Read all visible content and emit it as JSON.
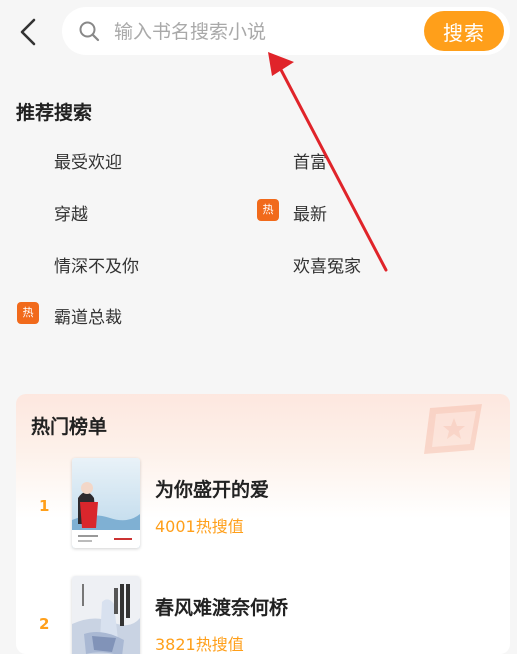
{
  "search": {
    "placeholder": "输入书名搜索小说",
    "button_label": "搜索"
  },
  "recommend": {
    "title": "推荐搜索",
    "hot_tag_label": "热",
    "items": [
      {
        "label": "最受欢迎",
        "hot": false
      },
      {
        "label": "首富",
        "hot": false
      },
      {
        "label": "穿越",
        "hot": false
      },
      {
        "label": "最新",
        "hot": true
      },
      {
        "label": "情深不及你",
        "hot": false
      },
      {
        "label": "欢喜冤家",
        "hot": false
      },
      {
        "label": "霸道总裁",
        "hot": true
      }
    ]
  },
  "ranking": {
    "title": "热门榜单",
    "books": [
      {
        "rank": "1",
        "title": "为你盛开的爱",
        "heat": "4001热搜值"
      },
      {
        "rank": "2",
        "title": "春风难渡奈何桥",
        "heat": "3821热搜值"
      }
    ]
  },
  "colors": {
    "accent": "#ff9f1a",
    "hot_tag": "#f16a1b",
    "annotation_arrow": "#e0242a"
  },
  "icons": {
    "back": "chevron-left-icon",
    "search": "search-icon",
    "hot": "hot-tag-icon",
    "ranking_decoration": "flag-decoration-icon"
  }
}
